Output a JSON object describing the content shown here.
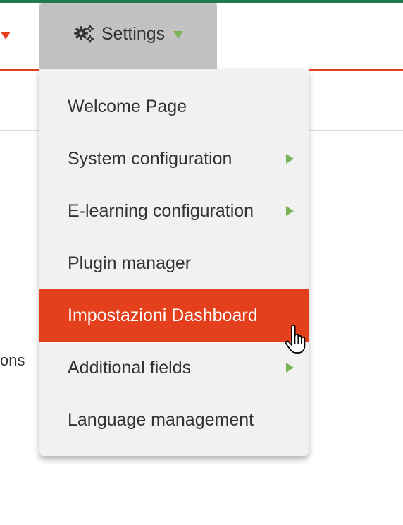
{
  "nav": {
    "settings_label": "Settings",
    "settings_icon": "gears-icon",
    "previous_tab_caret_color": "#e5401e"
  },
  "background": {
    "partial_text": "ons"
  },
  "menu": {
    "items": [
      {
        "label": "Welcome Page",
        "has_submenu": false,
        "active": false
      },
      {
        "label": "System configuration",
        "has_submenu": true,
        "active": false
      },
      {
        "label": "E-learning configuration",
        "has_submenu": true,
        "active": false
      },
      {
        "label": "Plugin manager",
        "has_submenu": false,
        "active": false
      },
      {
        "label": "Impostazioni Dashboard",
        "has_submenu": false,
        "active": true
      },
      {
        "label": "Additional fields",
        "has_submenu": true,
        "active": false
      },
      {
        "label": "Language management",
        "has_submenu": false,
        "active": false
      }
    ]
  },
  "colors": {
    "accent": "#e5401e",
    "submenu_arrow": "#79b357",
    "top_strip": "#1f7a4a",
    "tab_bg": "#c2c2c2",
    "menu_bg": "#f1f1f1"
  }
}
